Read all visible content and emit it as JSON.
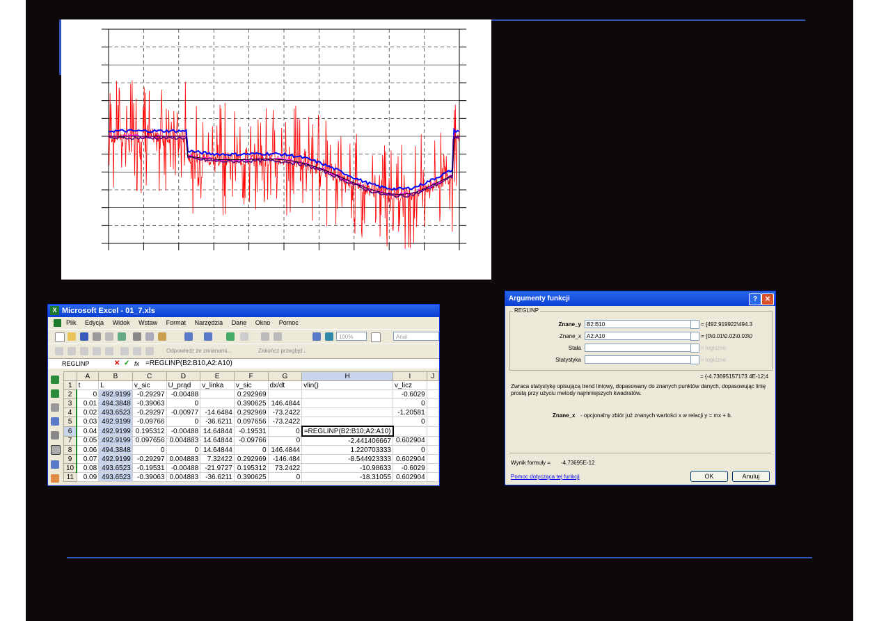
{
  "chart_data": {
    "type": "line",
    "title": "",
    "xlabel": "",
    "ylabel": "",
    "grid": true,
    "legend": "none",
    "series": [
      {
        "color": "#ff0000",
        "description": "raw noisy signal"
      },
      {
        "color": "#0000ff",
        "description": "smoothed"
      },
      {
        "color": "#ff00ff",
        "description": "smoothed"
      },
      {
        "color": "#4b0082",
        "description": "smoothed"
      },
      {
        "color": "#000000",
        "description": "step"
      }
    ],
    "levels": {
      "start": 0.0,
      "after_drop": -0.55,
      "end_plateau": -1.75,
      "final": 0.0
    },
    "ylim": [
      -3.0,
      3.0
    ],
    "xlim": [
      0,
      10
    ]
  },
  "excel": {
    "title": "Microsoft Excel - 01_7.xls",
    "icon": "excel-icon",
    "menu": [
      "Plik",
      "Edycja",
      "Widok",
      "Wstaw",
      "Format",
      "Narzędzia",
      "Dane",
      "Okno",
      "Pomoc"
    ],
    "zoom": "100%",
    "font": "Arial",
    "review_text": "Odpowiedz ze zmianami...",
    "end_review": "Zakończ przegląd...",
    "namebox": "REGLINP",
    "formula": "=REGLINP(B2:B10,A2:A10)",
    "columns": [
      "A",
      "B",
      "C",
      "D",
      "E",
      "F",
      "G",
      "H",
      "I",
      "J"
    ],
    "rows": [
      {
        "n": "1",
        "cells": [
          "t",
          "L",
          "v_sic",
          "U_prąd",
          "v_linka",
          "v_sic",
          "dx/dt",
          "vlin()",
          "v_licz",
          ""
        ]
      },
      {
        "n": "2",
        "cells": [
          "0",
          "492.9199",
          "-0.29297",
          "-0.00488",
          "",
          "0.292969",
          "",
          "",
          "-0.6029",
          ""
        ]
      },
      {
        "n": "3",
        "cells": [
          "0.01",
          "494.3848",
          "-0.39063",
          "0",
          "",
          "0.390625",
          "146.4844",
          "",
          "0",
          ""
        ]
      },
      {
        "n": "4",
        "cells": [
          "0.02",
          "493.6523",
          "-0.29297",
          "-0.00977",
          "-14.6484",
          "0.292969",
          "-73.2422",
          "",
          "-1.20581",
          ""
        ]
      },
      {
        "n": "5",
        "cells": [
          "0.03",
          "492.9199",
          "-0.09766",
          "0",
          "-36.6211",
          "0.097656",
          "-73.2422",
          "",
          "0",
          ""
        ]
      },
      {
        "n": "6",
        "cells": [
          "0.04",
          "492.9199",
          "0.195312",
          "-0.00488",
          "14.64844",
          "-0.19531",
          "0",
          "=REGLINP(B2:B10;A2:A10)",
          "",
          ""
        ]
      },
      {
        "n": "7",
        "cells": [
          "0.05",
          "492.9199",
          "0.097656",
          "0.004883",
          "14.64844",
          "-0.09766",
          "0",
          "-2.441406667",
          "0.602904",
          ""
        ]
      },
      {
        "n": "8",
        "cells": [
          "0.06",
          "494.3848",
          "0",
          "0",
          "14.64844",
          "0",
          "146.4844",
          "1.220703333",
          "0",
          ""
        ]
      },
      {
        "n": "9",
        "cells": [
          "0.07",
          "492.9199",
          "-0.29297",
          "0.004883",
          "7.32422",
          "0.292969",
          "-146.484",
          "-8.544923333",
          "0.602904",
          ""
        ]
      },
      {
        "n": "10",
        "cells": [
          "0.08",
          "493.6523",
          "-0.19531",
          "-0.00488",
          "-21.9727",
          "0.195312",
          "73.2422",
          "-10.98633",
          "-0.6029",
          ""
        ]
      },
      {
        "n": "11",
        "cells": [
          "0.09",
          "493.6523",
          "-0.39063",
          "0.004883",
          "-36.6211",
          "0.390625",
          "0",
          "-18.31055",
          "0.602904",
          ""
        ]
      }
    ]
  },
  "dialog": {
    "title": "Argumenty funkcji",
    "group": "REGLINP",
    "args": [
      {
        "name": "Znane_y",
        "bold": true,
        "value": "B2:B10",
        "result": "= {492.919922\\494.3"
      },
      {
        "name": "Znane_x",
        "bold": false,
        "value": "A2:A10",
        "result": "= {0\\0.01\\0.02\\0.03\\0"
      },
      {
        "name": "Stała",
        "bold": false,
        "value": "",
        "result": "= logiczne"
      },
      {
        "name": "Statystyka",
        "bold": false,
        "value": "",
        "result": "= logiczne"
      }
    ],
    "total": "= {-4.73695157173 4E-12;4",
    "description": "Zwraca statystykę opisującą trend liniowy, dopasowany do znanych punktów danych, dopasowując linię prostą przy użyciu metody najmniejszych kwadratów.",
    "arg_help_name": "Znane_x",
    "arg_help": "- opcjonalny zbiór już znanych wartości x w relacji y = mx + b.",
    "result_label": "Wynik formuły =",
    "result_value": "-4.73695E-12",
    "help_link": "Pomoc dotycząca tej funkcji",
    "ok": "OK",
    "cancel": "Anuluj"
  }
}
